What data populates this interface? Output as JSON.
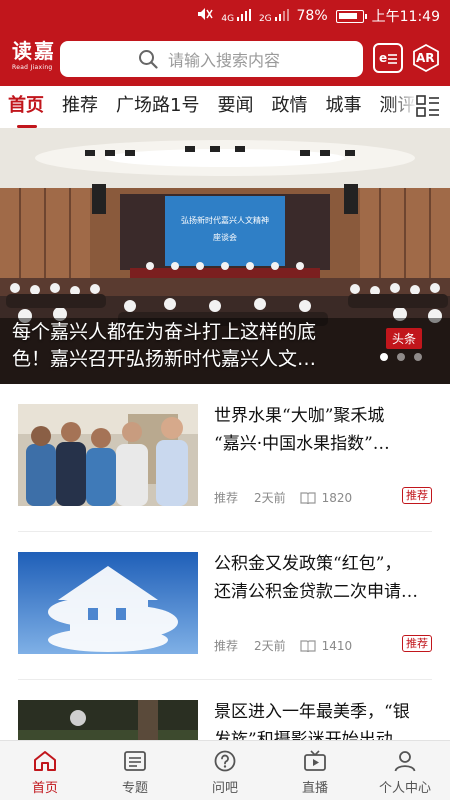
{
  "status_bar": {
    "signal_labels": [
      "4G",
      "2G"
    ],
    "battery": "78%",
    "time": "上午11:49"
  },
  "header": {
    "logo_cn": "读嘉",
    "logo_en": "Read Jiaxing",
    "search_placeholder": "请输入搜索内容",
    "epaper_icon": "epaper-icon",
    "ar_label": "AR"
  },
  "tabs": [
    "首页",
    "推荐",
    "广场路1号",
    "要闻",
    "政情",
    "城事",
    "测评"
  ],
  "active_tab": "首页",
  "hero": {
    "screen_text_line1": "弘扬新时代嘉兴人文精神",
    "screen_text_line2": "座谈会",
    "caption_line1": "每个嘉兴人都在为奋斗打上这样的底",
    "caption_line2": "色！嘉兴召开弘扬新时代嘉兴人文…",
    "tag": "头条",
    "dots": 3,
    "active_dot": 0
  },
  "news": [
    {
      "title": "世界水果“大咖”聚禾城“嘉兴·中国水果指数”…",
      "title_line1": "世界水果“大咖”聚禾城",
      "title_line2": "“嘉兴·中国水果指数”…",
      "category": "推荐",
      "time": "2天前",
      "views": "1820",
      "badge": "推荐"
    },
    {
      "title": "公积金又发政策“红包”，还清公积金贷款二次申请…",
      "title_line1": "公积金又发政策“红包”，",
      "title_line2": "还清公积金贷款二次申请…",
      "category": "推荐",
      "time": "2天前",
      "views": "1410",
      "badge": "推荐"
    },
    {
      "title": "景区进入一年最美季，“银发族”和摄影迷开始出动",
      "title_line1": "景区进入一年最美季，“银",
      "title_line2": "发族”和摄影迷开始出动",
      "category": "",
      "time": "",
      "views": "",
      "badge": ""
    }
  ],
  "bottom_nav": [
    {
      "label": "首页",
      "icon": "home-icon",
      "active": true
    },
    {
      "label": "专题",
      "icon": "topic-icon",
      "active": false
    },
    {
      "label": "问吧",
      "icon": "question-icon",
      "active": false
    },
    {
      "label": "直播",
      "icon": "live-tv-icon",
      "active": false
    },
    {
      "label": "个人中心",
      "icon": "user-icon",
      "active": false
    }
  ],
  "colors": {
    "brand_red": "#c1161c",
    "text": "#111111",
    "meta": "#8a8a8a"
  }
}
